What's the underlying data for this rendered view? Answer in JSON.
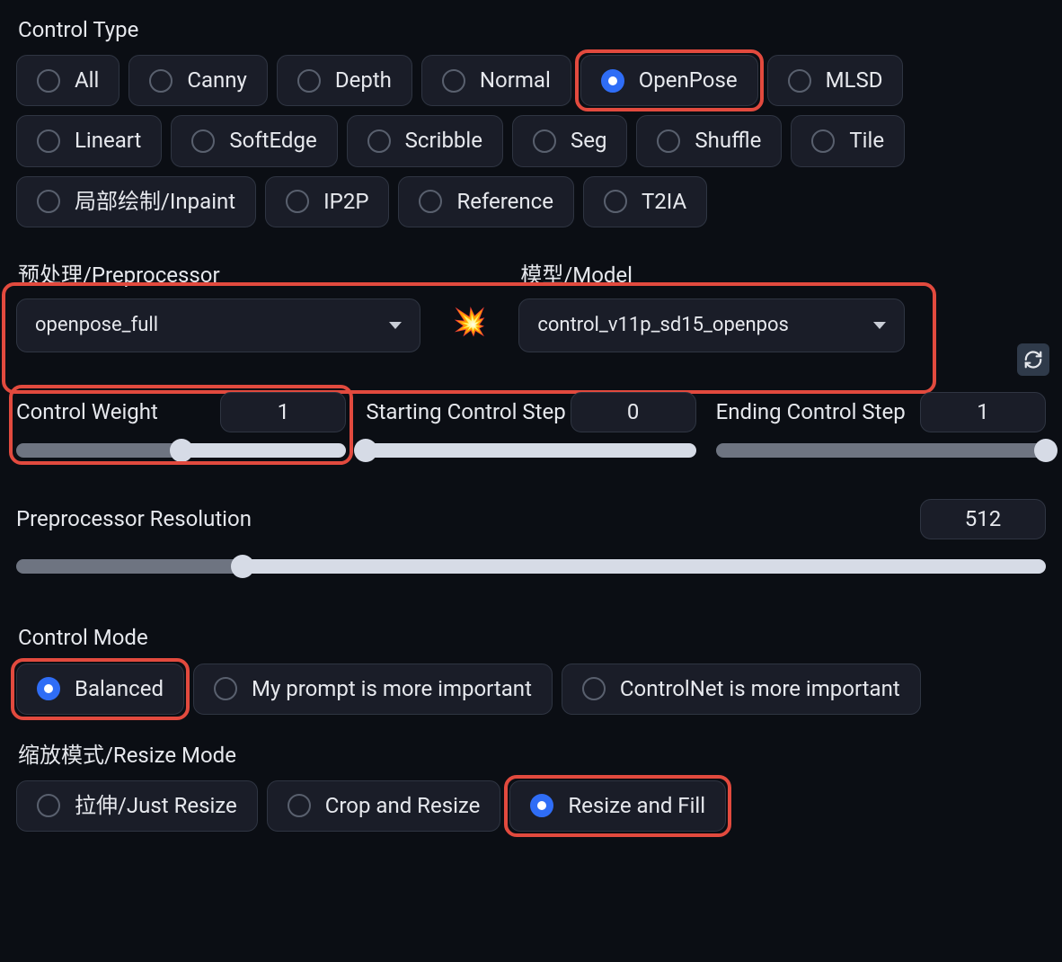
{
  "control_type": {
    "label": "Control Type",
    "options": [
      "All",
      "Canny",
      "Depth",
      "Normal",
      "OpenPose",
      "MLSD",
      "Lineart",
      "SoftEdge",
      "Scribble",
      "Seg",
      "Shuffle",
      "Tile",
      "局部绘制/Inpaint",
      "IP2P",
      "Reference",
      "T2IA"
    ],
    "selected": "OpenPose"
  },
  "preprocessor": {
    "label": "预处理/Preprocessor",
    "value": "openpose_full"
  },
  "model": {
    "label": "模型/Model",
    "value": "control_v11p_sd15_openpos"
  },
  "explode_icon": "💥",
  "sliders": {
    "weight": {
      "label": "Control Weight",
      "value": "1",
      "percent": 50
    },
    "start": {
      "label": "Starting Control Step",
      "value": "0",
      "percent": 0
    },
    "end": {
      "label": "Ending Control Step",
      "value": "1",
      "percent": 100
    }
  },
  "resolution": {
    "label": "Preprocessor Resolution",
    "value": "512",
    "percent": 22
  },
  "control_mode": {
    "label": "Control Mode",
    "options": [
      "Balanced",
      "My prompt is more important",
      "ControlNet is more important"
    ],
    "selected": "Balanced"
  },
  "resize_mode": {
    "label": "缩放模式/Resize Mode",
    "options": [
      "拉伸/Just Resize",
      "Crop and Resize",
      "Resize and Fill"
    ],
    "selected": "Resize and Fill"
  }
}
